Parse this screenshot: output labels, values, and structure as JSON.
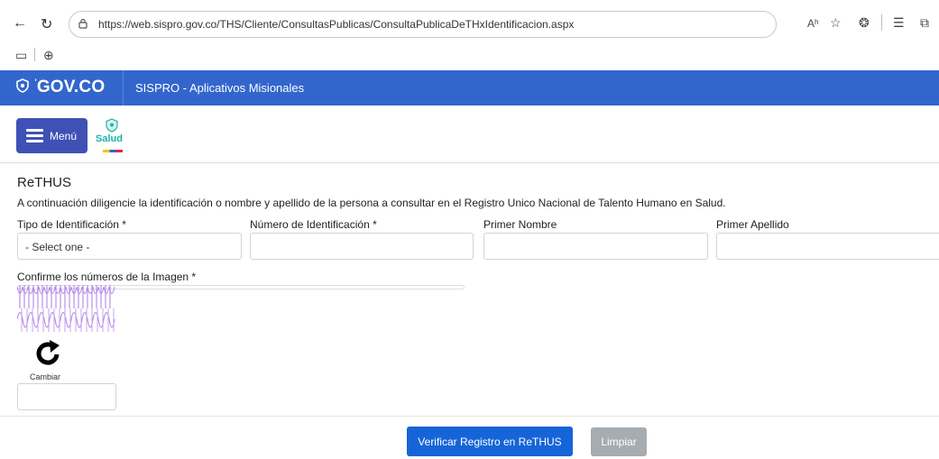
{
  "browser": {
    "url": "https://web.sispro.gov.co/THS/Cliente/ConsultasPublicas/ConsultaPublicaDeTHxIdentificacion.aspx",
    "read_aloud_glyph": "Aʰ"
  },
  "header": {
    "logo_text": "GOV.CO",
    "site_title": "SISPRO - Aplicativos Misionales"
  },
  "appbar": {
    "menu_label": "Menú",
    "logo_text": "Salud"
  },
  "form": {
    "title": "ReTHUS",
    "intro": "A continuación diligencie la identificación o nombre y apellido de la persona a consultar en el Registro Unico Nacional de Talento Humano en Salud.",
    "tipo_label": "Tipo de Identificación *",
    "tipo_value": "- Select one -",
    "numero_label": "Número de Identificación *",
    "nombre_label": "Primer Nombre",
    "apellido_label": "Primer Apellido",
    "captcha_label": "Confirme los números de la Imagen *",
    "refresh_label": "Cambiar",
    "verify_button": "Verificar Registro en ReTHUS",
    "clear_button": "Limpiar"
  },
  "colors": {
    "gov_blue": "#3366cc",
    "menu_button": "#3f51b5",
    "verify_button": "#1565d8",
    "clear_button": "#a7acb1"
  }
}
